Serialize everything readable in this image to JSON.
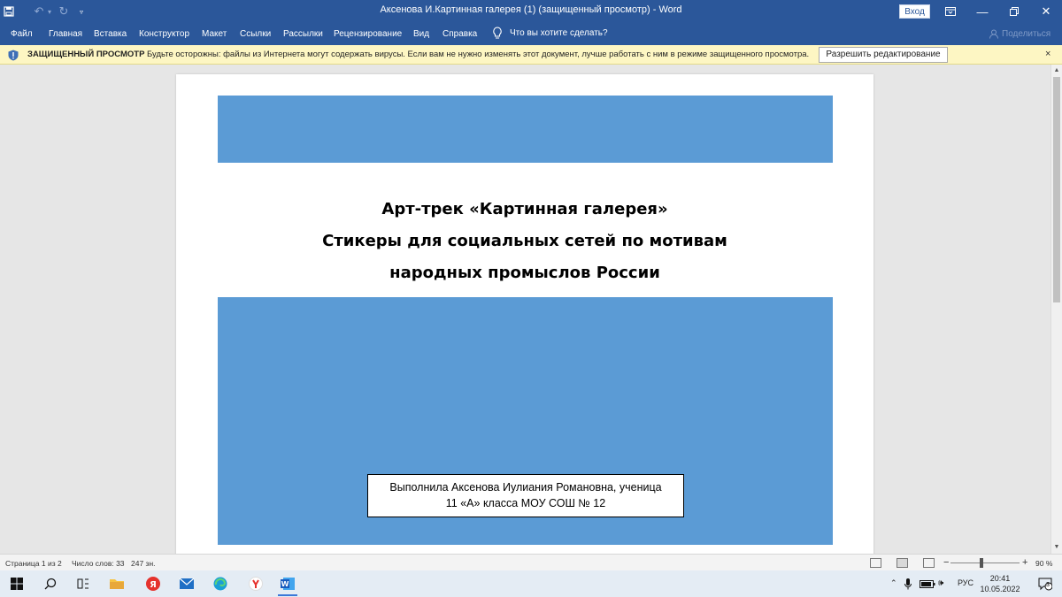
{
  "window": {
    "title": "Аксенова И.Картинная галерея (1) (защищенный просмотр)  -  Word",
    "signin_label": "Вход"
  },
  "menu": {
    "items": [
      "Файл",
      "Главная",
      "Вставка",
      "Конструктор",
      "Макет",
      "Ссылки",
      "Рассылки",
      "Рецензирование",
      "Вид",
      "Справка"
    ],
    "tell_me": "Что вы хотите сделать?",
    "share": "Поделиться"
  },
  "protected_view": {
    "title": "ЗАЩИЩЕННЫЙ ПРОСМОТР",
    "message": "Будьте осторожны: файлы из Интернета могут содержать вирусы. Если вам не нужно изменять этот документ, лучше работать с ним в режиме защищенного просмотра.",
    "enable_button": "Разрешить редактирование",
    "close": "×"
  },
  "document": {
    "heading_lines": [
      "Арт-трек «Картинная галерея»",
      "Стикеры для социальных сетей по мотивам",
      "народных промыслов России"
    ],
    "author_lines": [
      "Выполнила Аксенова Иулиания Романовна, ученица",
      "11 «А» класса МОУ СОШ № 12"
    ],
    "shape_color": "#5b9bd5"
  },
  "status": {
    "page": "Страница 1 из 2",
    "words": "Число слов: 33",
    "chars": "247 зн.",
    "zoom": "90 %",
    "zoom_minus": "−",
    "zoom_plus": "+"
  },
  "taskbar": {
    "language": "РУС",
    "time": "20:41",
    "date": "10.05.2022",
    "notifications": "3"
  },
  "colors": {
    "word_blue": "#2b579a",
    "protected_bar": "#fdf6c3"
  }
}
